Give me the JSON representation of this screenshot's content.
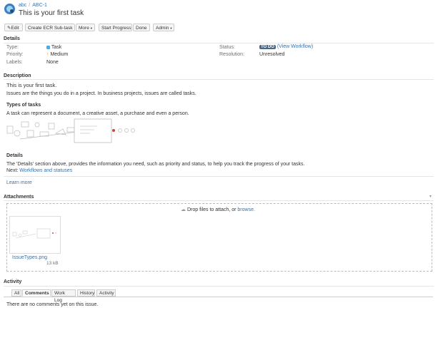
{
  "breadcrumb": {
    "project": "abc",
    "issue_key": "ABC-1"
  },
  "issue": {
    "title": "This is your first task"
  },
  "toolbar": {
    "edit": "Edit",
    "create_subtask": "Create ECR Sub-task",
    "more": "More",
    "start_progress": "Start Progress",
    "done": "Done",
    "admin": "Admin"
  },
  "details": {
    "heading": "Details",
    "type_label": "Type:",
    "type_value": "Task",
    "priority_label": "Priority:",
    "priority_value": "Medium",
    "labels_label": "Labels:",
    "labels_value": "None",
    "status_label": "Status:",
    "status_value": "TO DO",
    "view_workflow": "(View Workflow)",
    "resolution_label": "Resolution:",
    "resolution_value": "Unresolved"
  },
  "description": {
    "heading": "Description",
    "intro": "This is your first task.",
    "line1": "Issues are the things you do in a project. In business projects, issues are called tasks.",
    "types_heading": "Types of tasks",
    "types_text": "A task can represent a document, a creative asset, a purchase and even a person.",
    "details_heading": "Details",
    "details_text": "The 'Details' section above, provides the information you need, such as priority and status, to help you track the progress of your tasks.",
    "next_label": "Next:",
    "next_link": "Workflows and statuses",
    "learn_more": "Learn more"
  },
  "attachments": {
    "heading": "Attachments",
    "drop_text": "Drop files to attach, or",
    "browse": "browse.",
    "file_name": "IssueTypes.png",
    "file_size": "13 kB"
  },
  "activity": {
    "heading": "Activity",
    "tabs": [
      "All",
      "Comments",
      "Work Log",
      "History",
      "Activity"
    ],
    "empty": "There are no comments yet on this issue."
  },
  "colors": {
    "link": "#3572b0",
    "status_badge": "#4a6785",
    "priority": "#f79232",
    "task_icon": "#4bade8"
  }
}
